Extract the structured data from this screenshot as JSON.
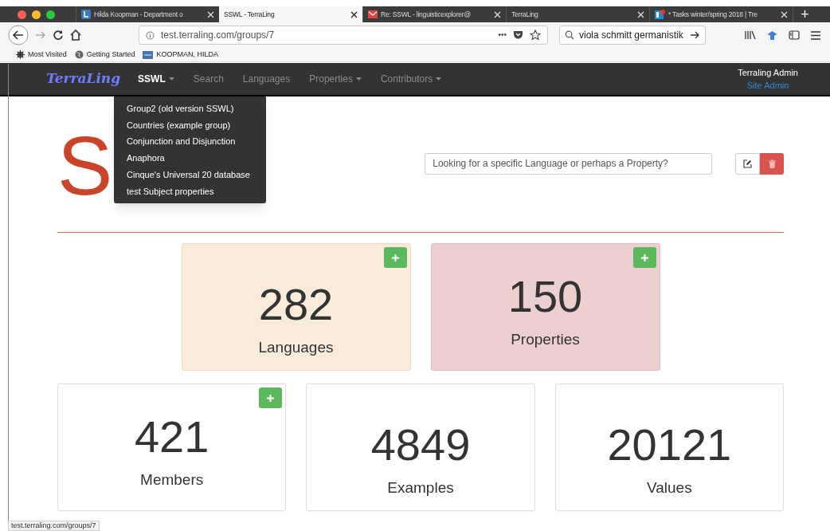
{
  "browser": {
    "tabs": [
      {
        "title": "Hilda Koopman - Department o",
        "kind": "letter",
        "selected": false
      },
      {
        "title": "SSWL - TerraLing",
        "kind": "plain",
        "selected": true
      },
      {
        "title": "Re: SSWL - linguisticexplorer@",
        "kind": "mail",
        "selected": false
      },
      {
        "title": "TerraLing",
        "kind": "plain",
        "selected": false
      },
      {
        "title": "* Tasks winter/spring 2018 | Tre",
        "kind": "board",
        "selected": false
      }
    ],
    "more_menu": "•••",
    "new_tab": "+",
    "address": "test.terraling.com/groups/7",
    "search_value": "viola schmitt germanistik",
    "bookmarks": [
      {
        "label": "Most Visited",
        "kind": "gear"
      },
      {
        "label": "Getting Started",
        "kind": "globe"
      },
      {
        "label": "KOOPMAN, HILDA",
        "kind": "badge"
      }
    ],
    "status_url": "test.terraling.com/groups/7"
  },
  "navbar": {
    "brand": "TerraLing",
    "items": [
      {
        "label": "SSWL",
        "dropdown": true,
        "selected": true
      },
      {
        "label": "Search",
        "dropdown": false,
        "selected": false
      },
      {
        "label": "Languages",
        "dropdown": false,
        "selected": false
      },
      {
        "label": "Properties",
        "dropdown": true,
        "selected": false
      },
      {
        "label": "Contributors",
        "dropdown": true,
        "selected": false
      }
    ],
    "user": "Terraling Admin",
    "user_link": "Site Admin"
  },
  "dropdown": {
    "items": [
      "Group2 (old version SSWL)",
      "Countries (example group)",
      "Conjunction and Disjunction",
      "Anaphora",
      "Cinque's Universal 20 database",
      "test Subject properties"
    ]
  },
  "page": {
    "title": "S",
    "search_placeholder": "Looking for a specific Language or perhaps a Property?"
  },
  "stats_top": [
    {
      "value": "282",
      "label": "Languages",
      "kind": "warning",
      "add": true
    },
    {
      "value": "150",
      "label": "Properties",
      "kind": "danger",
      "add": true
    }
  ],
  "stats_bottom": [
    {
      "value": "421",
      "label": "Members",
      "kind": "plain",
      "add": true
    },
    {
      "value": "4849",
      "label": "Examples",
      "kind": "plain",
      "add": false
    },
    {
      "value": "20121",
      "label": "Values",
      "kind": "plain",
      "add": false
    }
  ]
}
